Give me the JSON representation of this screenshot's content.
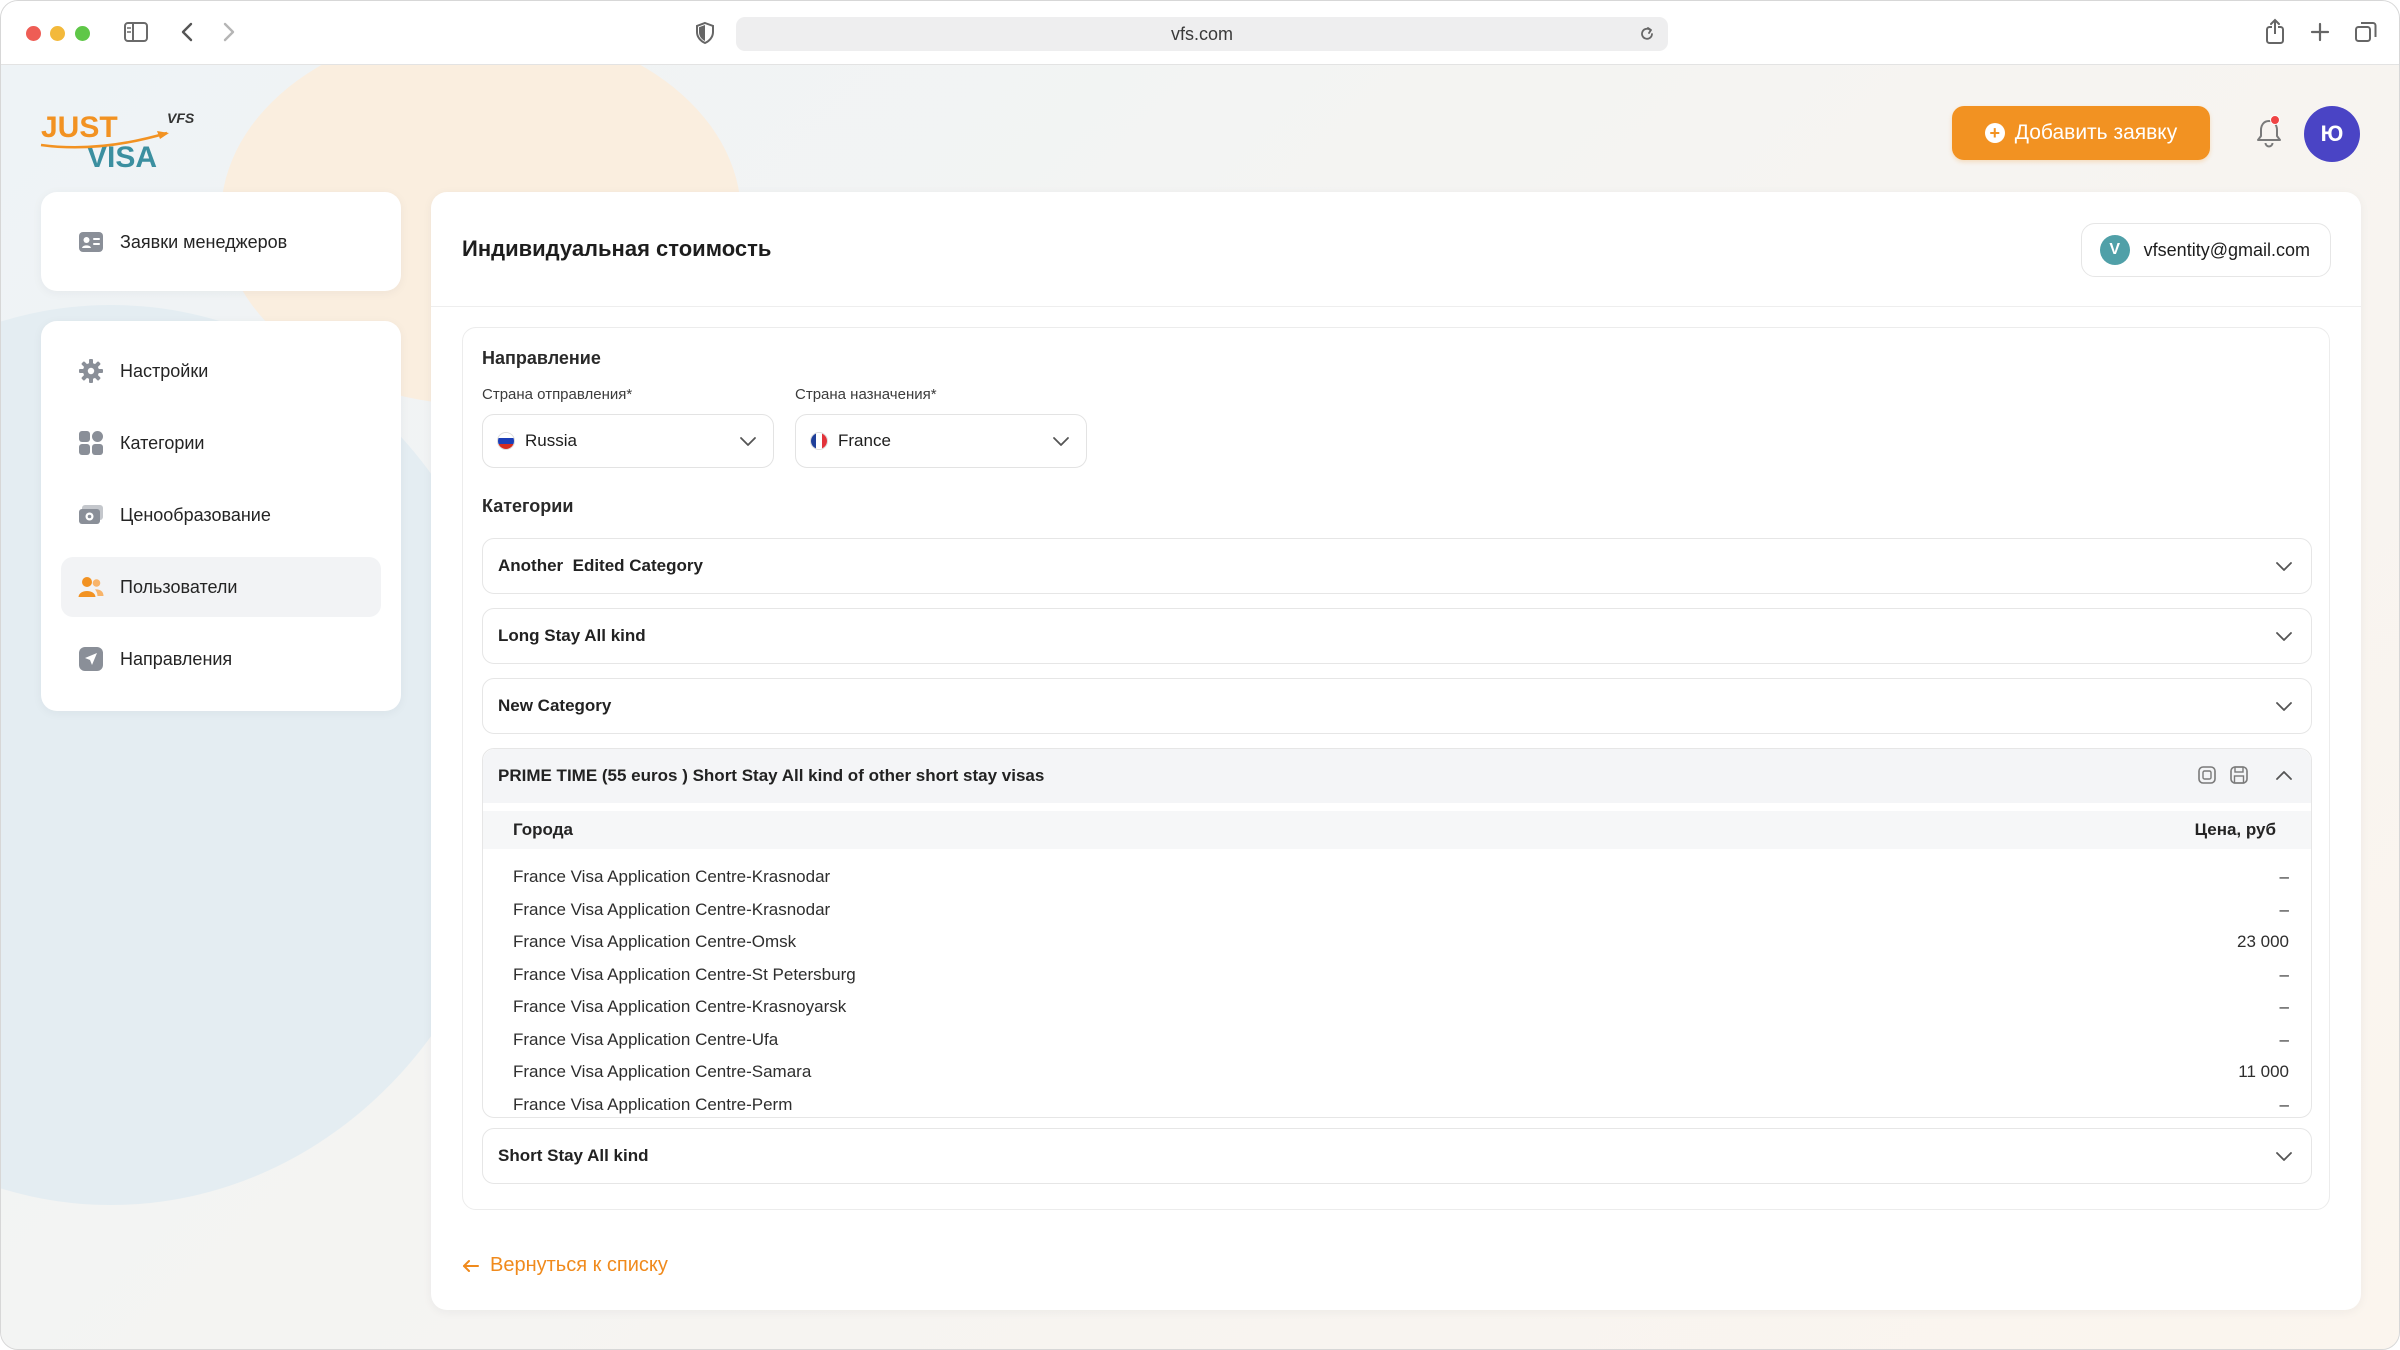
{
  "browser": {
    "url": "vfs.com"
  },
  "header": {
    "logo": {
      "line1": "JUST",
      "line2": "VISA",
      "tag": "VFS"
    },
    "add_button_label": "Добавить заявку",
    "avatar_letter": "Ю"
  },
  "sidebar": {
    "top_item": {
      "label": "Заявки менеджеров",
      "icon": "id-card-icon"
    },
    "items": [
      {
        "label": "Настройки",
        "icon": "gear-icon"
      },
      {
        "label": "Категории",
        "icon": "grid-icon"
      },
      {
        "label": "Ценообразование",
        "icon": "money-icon"
      },
      {
        "label": "Пользователи",
        "icon": "users-icon",
        "active": true
      },
      {
        "label": "Направления",
        "icon": "send-icon"
      }
    ]
  },
  "main": {
    "title": "Индивидуальная стоимость",
    "email_chip": {
      "letter": "V",
      "email": "vfsentity@gmail.com"
    },
    "direction": {
      "section_label": "Направление",
      "departure_label": "Страна отправления*",
      "departure_value": "Russia",
      "destination_label": "Страна назначения*",
      "destination_value": "France"
    },
    "categories_label": "Категории",
    "categories": [
      {
        "name": "Another  Edited Category",
        "open": false
      },
      {
        "name": "Long Stay All kind",
        "open": false
      },
      {
        "name": "New Category",
        "open": false
      },
      {
        "name": "PRIME TIME (55 euros ) Short Stay All kind of other short stay visas",
        "open": true
      },
      {
        "name": "Short Stay All kind",
        "open": false
      }
    ],
    "open_table": {
      "col_city": "Города",
      "col_price": "Цена, руб",
      "rows": [
        {
          "city": "France Visa Application Centre-Krasnodar",
          "price": "–"
        },
        {
          "city": "France Visa Application Centre-Krasnodar",
          "price": "–"
        },
        {
          "city": "France Visa Application Centre-Omsk",
          "price": "23 000"
        },
        {
          "city": "France Visa Application Centre-St Petersburg",
          "price": "–"
        },
        {
          "city": "France Visa Application Centre-Krasnoyarsk",
          "price": "–"
        },
        {
          "city": "France Visa Application Centre-Ufa",
          "price": "–"
        },
        {
          "city": "France Visa Application Centre-Samara",
          "price": "11 000"
        },
        {
          "city": "France Visa Application Centre-Perm",
          "price": "–"
        }
      ]
    },
    "back_link": "Вернуться к списку"
  },
  "colors": {
    "accent": "#f29222",
    "avatar": "#4a44c5",
    "email_avatar": "#50a0a8",
    "logo_orange": "#f29222",
    "logo_teal": "#3b8fa0"
  }
}
